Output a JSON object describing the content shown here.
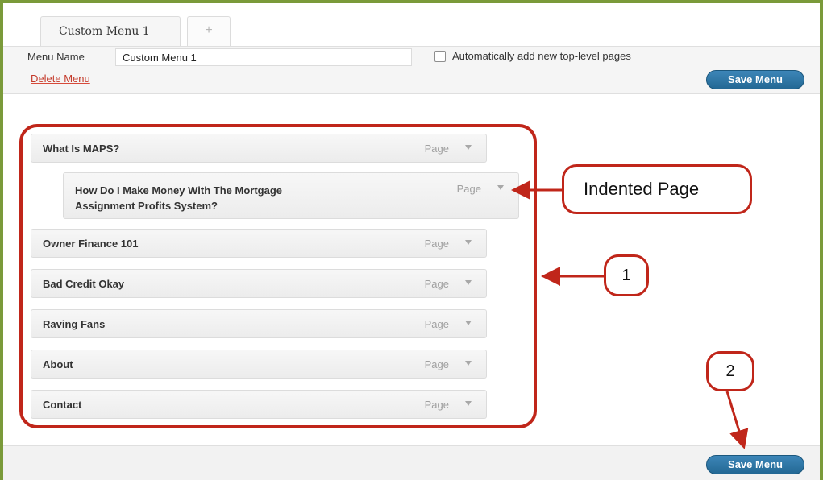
{
  "tabs": [
    {
      "label": "Custom Menu 1"
    },
    {
      "label": "+"
    }
  ],
  "header": {
    "menu_name_label": "Menu Name",
    "menu_name_value": "Custom Menu 1",
    "auto_add_label": "Automatically add new top-level pages",
    "delete_label": "Delete Menu",
    "save_label": "Save Menu"
  },
  "menu_items": [
    {
      "title": "What Is MAPS?",
      "type": "Page"
    },
    {
      "title": "How Do I Make Money With The Mortgage Assignment Profits System?",
      "type": "Page",
      "line1": "How Do I Make Money With The Mortgage",
      "line2": "Assignment Profits System?"
    },
    {
      "title": "Owner Finance 101",
      "type": "Page"
    },
    {
      "title": "Bad Credit Okay",
      "type": "Page"
    },
    {
      "title": "Raving Fans",
      "type": "Page"
    },
    {
      "title": "About",
      "type": "Page"
    },
    {
      "title": "Contact",
      "type": "Page"
    }
  ],
  "footer": {
    "save_label": "Save Menu"
  },
  "annotations": {
    "indented_label": "Indented Page",
    "num1": "1",
    "num2": "2",
    "color": "#c0261a"
  }
}
